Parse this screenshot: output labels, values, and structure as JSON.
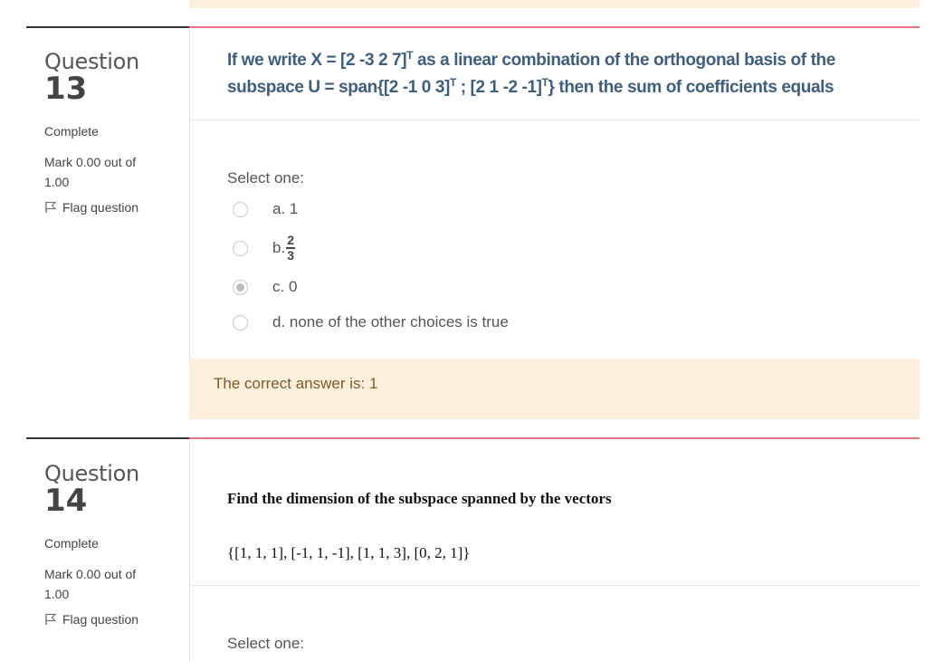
{
  "questions": [
    {
      "word": "Question",
      "number": "13",
      "state": "Complete",
      "grade": "Mark 0.00 out of 1.00",
      "flag": "Flag question",
      "text_line1": "If we write X = [2 -3 2 7]",
      "sup1": "T",
      "text_line1b": " as a linear combination of the orthogonal basis of the",
      "text_line2a": "subspace U = span{[2 -1 0 3]",
      "sup2": "T",
      "text_line2b": " ; [2 1 -2 -1]",
      "sup3": "T",
      "text_line2c": "} then the sum of coefficients equals",
      "select_one": "Select one:",
      "options": [
        {
          "label": "a. 1",
          "checked": false
        },
        {
          "prefix": "b.",
          "frac_num": "2",
          "frac_den": "3",
          "checked": false
        },
        {
          "label": "c. 0",
          "checked": true
        },
        {
          "label": "d. none of the other choices is true",
          "checked": false
        }
      ],
      "right_answer": "The correct answer is: 1"
    },
    {
      "word": "Question",
      "number": "14",
      "state": "Complete",
      "grade": "Mark 0.00 out of 1.00",
      "flag": "Flag question",
      "text_line1": "Find the dimension of the subspace spanned by the vectors",
      "text_line2": "{[1, 1, 1], [-1, 1, -1], [1, 1, 3], [0, 2, 1]}",
      "select_one": "Select one:"
    }
  ],
  "colors": {
    "question_text": "#3f5e7d",
    "separator_accent": "#e87682",
    "feedback_bg": "#fcefdc",
    "feedback_text": "#7d5a29"
  }
}
